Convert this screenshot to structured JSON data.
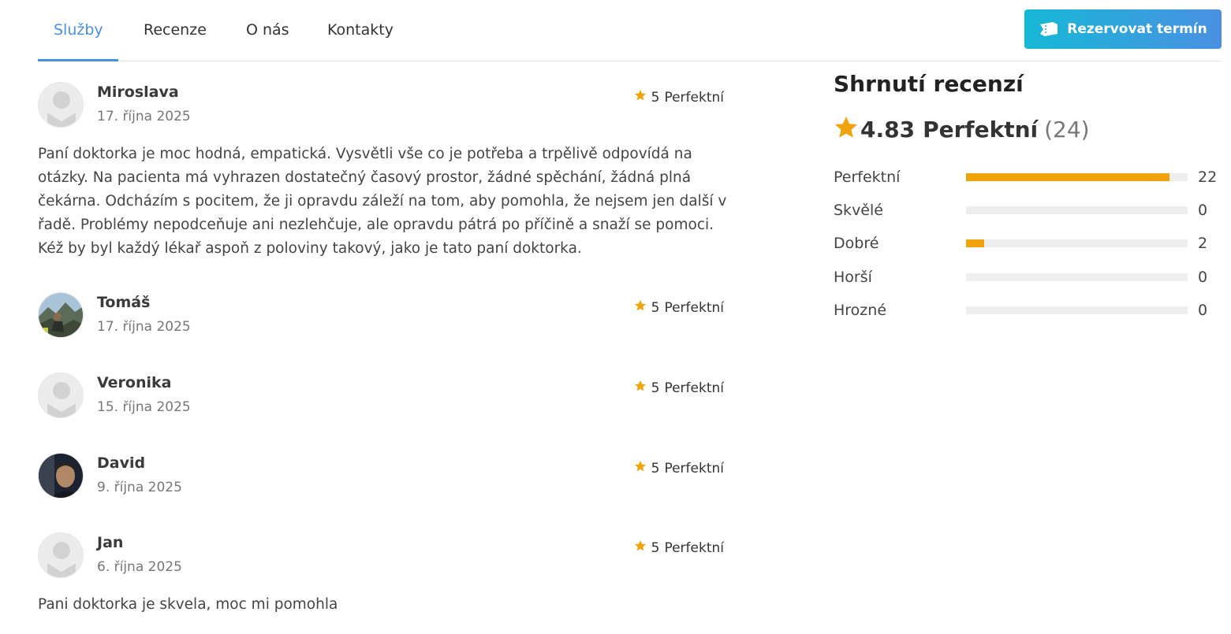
{
  "tabs": [
    {
      "label": "Služby",
      "active": true
    },
    {
      "label": "Recenze",
      "active": false
    },
    {
      "label": "O nás",
      "active": false
    },
    {
      "label": "Kontakty",
      "active": false
    }
  ],
  "book_button": {
    "label": "Rezervovat termín",
    "icon": "ticket-icon"
  },
  "reviews": [
    {
      "name": "Miroslava",
      "date": "17. října 2025",
      "rating": "5",
      "rating_label": "Perfektní",
      "avatar": "placeholder",
      "text": "Paní doktorka je moc hodná, empatická. Vysvětli vše co je potřeba a trpělivě odpovídá na otázky. Na pacienta má vyhrazen dostatečný časový prostor, žádné spěchání, žádná plná čekárna. Odcházím s pocitem, že ji opravdu záleží na tom, aby pomohla, že nejsem jen další v řadě. Problémy nepodceňuje ani nezlehčuje, ale opravdu pátrá po příčině a snaží se pomoci. Kéž by byl každý lékař aspoň z poloviny takový, jako je tato paní doktorka."
    },
    {
      "name": "Tomáš",
      "date": "17. října 2025",
      "rating": "5",
      "rating_label": "Perfektní",
      "avatar": "photo-mountains",
      "text": ""
    },
    {
      "name": "Veronika",
      "date": "15. října 2025",
      "rating": "5",
      "rating_label": "Perfektní",
      "avatar": "placeholder",
      "text": ""
    },
    {
      "name": "David",
      "date": "9. října 2025",
      "rating": "5",
      "rating_label": "Perfektní",
      "avatar": "photo-person",
      "text": ""
    },
    {
      "name": "Jan",
      "date": "6. října 2025",
      "rating": "5",
      "rating_label": "Perfektní",
      "avatar": "placeholder",
      "text": "Pani doktorka je skvela, moc mi pomohla"
    }
  ],
  "summary": {
    "title": "Shrnutí recenzí",
    "score": "4.83",
    "score_label": "Perfektní",
    "count": "(24)",
    "distribution": [
      {
        "label": "Perfektní",
        "count": 22,
        "fraction": 0.917
      },
      {
        "label": "Skvělé",
        "count": 0,
        "fraction": 0
      },
      {
        "label": "Dobré",
        "count": 2,
        "fraction": 0.083
      },
      {
        "label": "Horší",
        "count": 0,
        "fraction": 0
      },
      {
        "label": "Hrozné",
        "count": 0,
        "fraction": 0
      }
    ]
  },
  "colors": {
    "accent": "#4a90e2",
    "button_gradient_start": "#16b8d6",
    "button_gradient_end": "#4a90e2",
    "star": "#f0a30a",
    "bar_fill": "#f0a30a",
    "bar_track": "#eeeeee"
  }
}
